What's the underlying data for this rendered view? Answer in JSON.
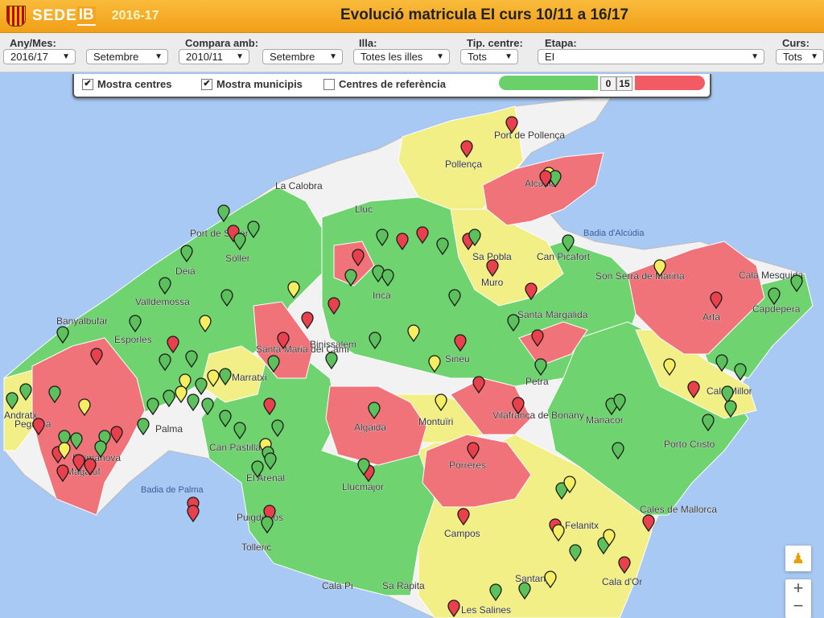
{
  "header": {
    "brand_sede": "SEDE",
    "brand_ib": "IB",
    "year": "2016-17",
    "title": "Evolució matricula EI curs 10/11 a 16/17"
  },
  "filters": {
    "any_mes": {
      "label": "Any/Mes:",
      "year": "2016/17",
      "month": "Setembre"
    },
    "compara": {
      "label": "Compara amb:",
      "year": "2010/11",
      "month": "Setembre"
    },
    "illa": {
      "label": "Illa:",
      "value": "Totes les illes"
    },
    "tip_centre": {
      "label": "Tip. centre:",
      "value": "Tots"
    },
    "etapa": {
      "label": "Etapa:",
      "value": "EI"
    },
    "curs": {
      "label": "Curs:",
      "value": "Tots"
    }
  },
  "controls": {
    "mostra_centres": {
      "label": "Mostra centres",
      "checked": true
    },
    "mostra_municipis": {
      "label": "Mostra municipis",
      "checked": true
    },
    "centres_referencia": {
      "label": "Centres de referència",
      "checked": false
    },
    "legend_low": "0",
    "legend_high": "15"
  },
  "map_labels": {
    "sea_alcudia": "Badia d'Alcúdia",
    "sea_palma": "Badia de Palma",
    "towns": [
      {
        "name": "Port de Pollença"
      },
      {
        "name": "Pollença"
      },
      {
        "name": "La Calobra"
      },
      {
        "name": "Lluc"
      },
      {
        "name": "Alcúdia"
      },
      {
        "name": "Port de Sóller"
      },
      {
        "name": "Sóller"
      },
      {
        "name": "Deià"
      },
      {
        "name": "Valldemossa"
      },
      {
        "name": "Banyalbufar"
      },
      {
        "name": "Esporles"
      },
      {
        "name": "Inca"
      },
      {
        "name": "Sa Pobla"
      },
      {
        "name": "Can Picafort"
      },
      {
        "name": "Muro"
      },
      {
        "name": "Son Serra de Marina"
      },
      {
        "name": "Cala Mesquida"
      },
      {
        "name": "Capdepera"
      },
      {
        "name": "Artà"
      },
      {
        "name": "Santa Margalida"
      },
      {
        "name": "Binissalem"
      },
      {
        "name": "Santa Maria del Camí"
      },
      {
        "name": "Marratxí"
      },
      {
        "name": "Sineu"
      },
      {
        "name": "Petra"
      },
      {
        "name": "Andratx"
      },
      {
        "name": "Palma"
      },
      {
        "name": "Palmanova"
      },
      {
        "name": "Peguera"
      },
      {
        "name": "Magaluf"
      },
      {
        "name": "Can Pastilla"
      },
      {
        "name": "Algaida"
      },
      {
        "name": "Montuïri"
      },
      {
        "name": "Vilafranca de Bonany"
      },
      {
        "name": "Manacor"
      },
      {
        "name": "Cala Millor"
      },
      {
        "name": "Porto Cristo"
      },
      {
        "name": "Porreres"
      },
      {
        "name": "Llucmajor"
      },
      {
        "name": "El Arenal"
      },
      {
        "name": "Puigderrós"
      },
      {
        "name": "Tolleric"
      },
      {
        "name": "Campos"
      },
      {
        "name": "Felanitx"
      },
      {
        "name": "Cales de Mallorca"
      },
      {
        "name": "Santanyí"
      },
      {
        "name": "Cala d'Or"
      },
      {
        "name": "Cala Pi"
      },
      {
        "name": "Sa Ràpita"
      },
      {
        "name": "Les Salines"
      }
    ]
  },
  "colors": {
    "green": "#6fd46f",
    "yellow": "#f2ef86",
    "red": "#f0737a",
    "sea": "#a8c9f4",
    "land_gray": "#f2f2f2"
  }
}
